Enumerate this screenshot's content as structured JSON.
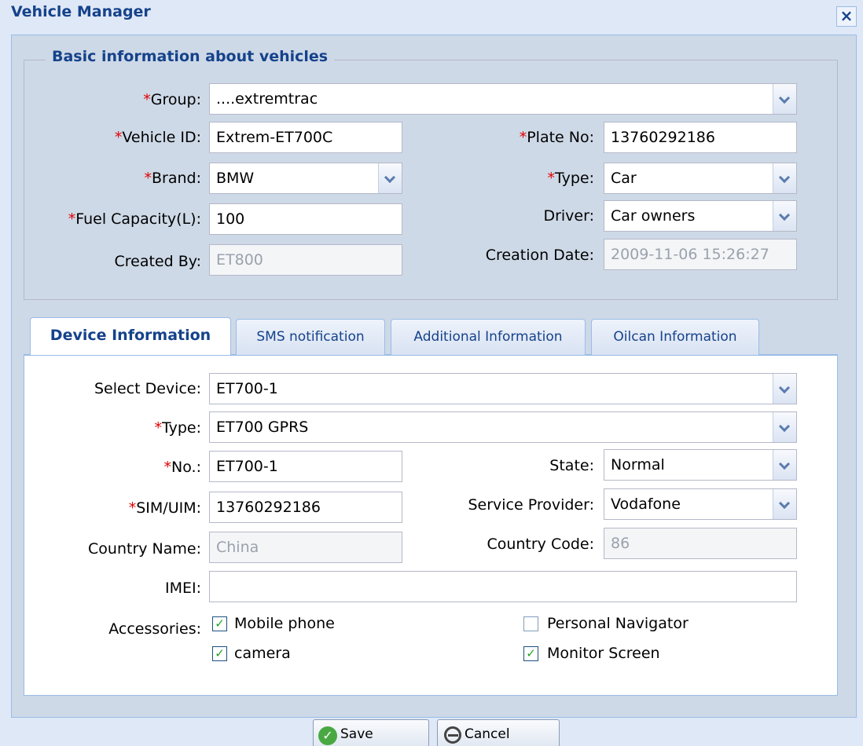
{
  "window": {
    "title": "Vehicle Manager",
    "close": "×"
  },
  "basic": {
    "legend": "Basic information about vehicles",
    "group_label": "Group:",
    "group_value": "....extremtrac",
    "vehicle_id_label": "Vehicle ID:",
    "vehicle_id_value": "Extrem-ET700C",
    "plate_label": "Plate No:",
    "plate_value": "13760292186",
    "brand_label": "Brand:",
    "brand_value": "BMW",
    "type_label": "Type:",
    "type_value": "Car",
    "fuel_label": "Fuel Capacity(L):",
    "fuel_value": "100",
    "driver_label": "Driver:",
    "driver_value": "Car owners",
    "created_by_label": "Created By:",
    "created_by_value": "ET800",
    "creation_date_label": "Creation Date:",
    "creation_date_value": "2009-11-06 15:26:27"
  },
  "tabs": [
    {
      "label": "Device Information",
      "active": true
    },
    {
      "label": "SMS notification",
      "active": false
    },
    {
      "label": "Additional Information",
      "active": false
    },
    {
      "label": "Oilcan Information",
      "active": false
    }
  ],
  "device": {
    "select_device_label": "Select Device:",
    "select_device_value": "ET700-1",
    "type_label": "Type:",
    "type_value": "ET700 GPRS",
    "no_label": "No.:",
    "no_value": "ET700-1",
    "state_label": "State:",
    "state_value": "Normal",
    "sim_label": "SIM/UIM:",
    "sim_value": "13760292186",
    "provider_label": "Service Provider:",
    "provider_value": "Vodafone",
    "country_name_label": "Country Name:",
    "country_name_placeholder": "China",
    "country_code_label": "Country Code:",
    "country_code_placeholder": "86",
    "imei_label": "IMEI:",
    "imei_value": "",
    "accessories_label": "Accessories:",
    "accessories": [
      {
        "label": "Mobile phone",
        "checked": true
      },
      {
        "label": "Personal Navigator",
        "checked": false
      },
      {
        "label": "camera",
        "checked": true
      },
      {
        "label": "Monitor Screen",
        "checked": true
      }
    ]
  },
  "required_mark": "*",
  "check_mark": "✓",
  "buttons": {
    "save": "Save",
    "cancel": "Cancel"
  },
  "colors": {
    "title": "#15428b",
    "required": "#e00000",
    "check": "#21a121"
  }
}
